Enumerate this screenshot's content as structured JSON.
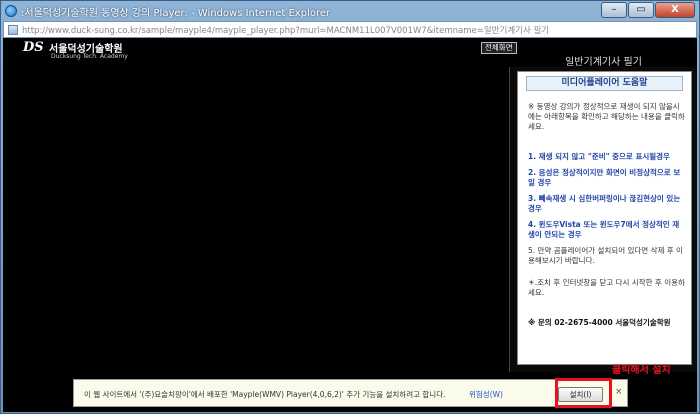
{
  "window": {
    "title": ":서울덕성기술학원 동영상 강의 Player: - Windows Internet Explorer",
    "minimize": "–",
    "maximize": "▭",
    "close": "X"
  },
  "address": {
    "url": "http://www.duck-sung.co.kr/sample/mayple4/mayple_player.php?murl=MACNM11L007V001W7&itemname=일반기계기사 필기"
  },
  "logo": {
    "mark": "DS",
    "name": "서울덕성기술학원",
    "english": "Ducksung Tech. Academy"
  },
  "player": {
    "fullscreen_label": "전체화면",
    "course_title": "일반기계기사 필기"
  },
  "help": {
    "header": "미디어플레이어 도움말",
    "intro": "※ 동영상 강의가 정상적으로 재생이 되지 않을시에는 아래항목을 확인하고 해당하는 내용을 클릭하세요.",
    "items": [
      "1. 재생 되지 않고 \"준비\" 중으로 표시될경우",
      "2. 음성은 정상적이지만 화면이 비정상적으로 보일 경우",
      "3. 빼속재생 시 심한버퍼링이나 끊김현상이 있는경우",
      "4. 윈도우Vista 또는 윈도우7에서 정상적인 재생이 안되는 경우"
    ],
    "note5": "5. 만약 곰플레이어가 설치되어 있다면 삭제 후 이용해보시기 바랍니다.",
    "note_restart": "☀.조치 후 인터넷창을 닫고 다시 시작한 후 이용하세요.",
    "contact": "※ 문의 02-2675-4000 서울덕성기술학원"
  },
  "infobar": {
    "message": "이 웹 사이트에서 '(주)요슬치팡이'에서 배포한 'Mayple(WMV) Player(4,0,6,2)' 추가 기능을 설치하려고 합니다.",
    "risk_link": "위험성(W)",
    "install_button": "설치(I)",
    "close": "×"
  },
  "callout": {
    "text": "클릭해서 설치"
  }
}
